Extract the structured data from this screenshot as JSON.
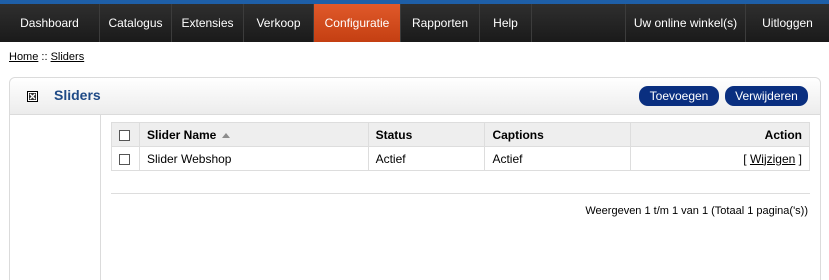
{
  "nav": {
    "left": [
      "Dashboard",
      "Catalogus",
      "Extensies",
      "Verkoop",
      "Configuratie",
      "Rapporten",
      "Help"
    ],
    "active_index": 4,
    "right": [
      "Uw online winkel(s)",
      "Uitloggen"
    ],
    "active_color": "#d34a1a"
  },
  "breadcrumb": {
    "home": "Home",
    "separator": " :: ",
    "current": "Sliders"
  },
  "box": {
    "title": "Sliders",
    "buttons": {
      "add": "Toevoegen",
      "delete": "Verwijderen"
    }
  },
  "table": {
    "headers": {
      "name": "Slider Name",
      "status": "Status",
      "captions": "Captions",
      "action": "Action"
    },
    "rows": [
      {
        "name": "Slider Webshop",
        "status": "Actief",
        "captions": "Actief",
        "action_prefix": "[ ",
        "action_link": "Wijzigen",
        "action_suffix": " ]"
      }
    ]
  },
  "pagination": "Weergeven 1 t/m 1 van 1 (Totaal 1 pagina('s))"
}
